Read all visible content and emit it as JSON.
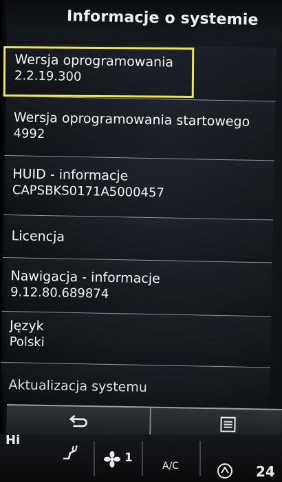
{
  "header": {
    "title": "Informacje o systemie"
  },
  "items": [
    {
      "label": "Wersja oprogramowania",
      "value": "2.2.19.300"
    },
    {
      "label": "Wersja oprogramowania startowego",
      "value": "4992"
    },
    {
      "label": "HUID - informacje",
      "value": "CAPSBKS0171A5000457"
    },
    {
      "label": "Licencja"
    },
    {
      "label": "Nawigacja - informacje",
      "value": "9.12.80.689874"
    },
    {
      "label": "Język",
      "value": "Polski"
    },
    {
      "label": "Aktualizacja systemu"
    }
  ],
  "footer": {
    "status_left": "Hi",
    "fan_level": "1",
    "ac_label": "A/C",
    "temp_right": "24"
  },
  "colors": {
    "highlight": "#f0e64a",
    "text": "#f2f4f6",
    "divider": "#8f979e"
  }
}
